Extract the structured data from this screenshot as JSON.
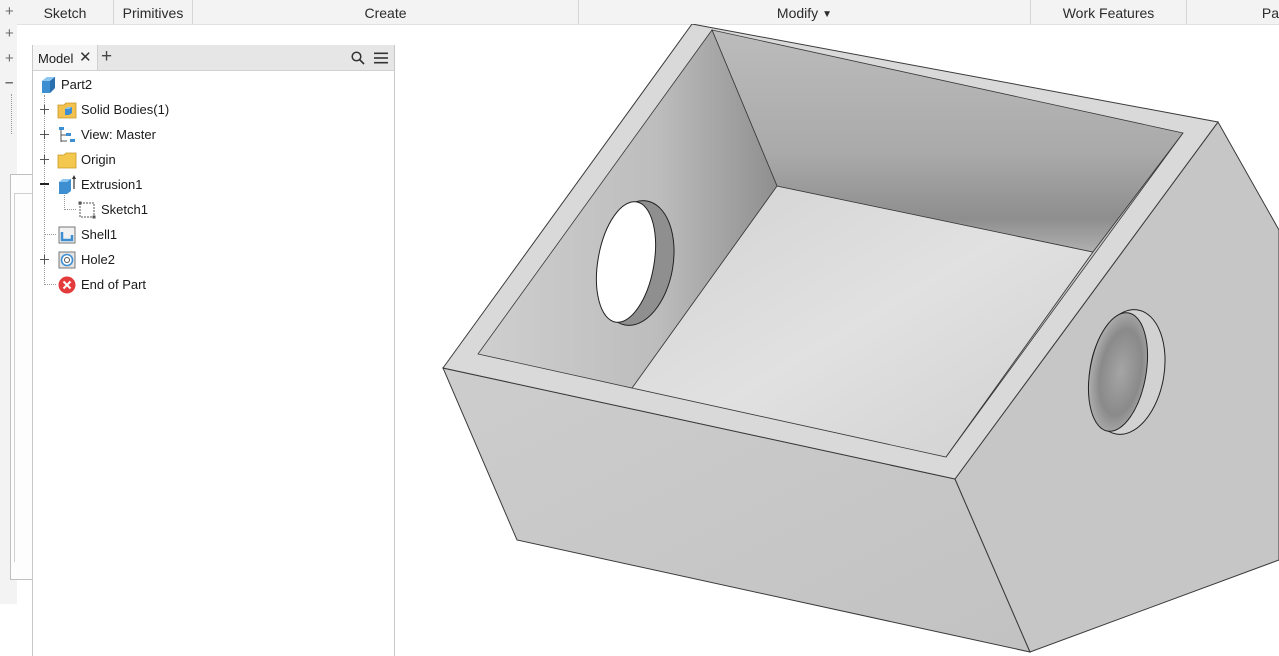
{
  "ribbon": {
    "tabs": [
      {
        "label": "Sketch"
      },
      {
        "label": "Primitives"
      },
      {
        "label": "Create"
      },
      {
        "label": "Modify"
      },
      {
        "label": "Work Features"
      },
      {
        "label": "Pa"
      }
    ]
  },
  "browser": {
    "tab_label": "Model",
    "tree": [
      {
        "label": "Part2",
        "icon": "part-icon"
      },
      {
        "label": "Solid Bodies(1)",
        "icon": "solid-bodies-folder-icon",
        "toggle": "plus"
      },
      {
        "label": "View: Master",
        "icon": "view-rep-icon",
        "toggle": "plus"
      },
      {
        "label": "Origin",
        "icon": "folder-icon",
        "toggle": "plus"
      },
      {
        "label": "Extrusion1",
        "icon": "extrusion-icon",
        "toggle": "minus"
      },
      {
        "label": "Sketch1",
        "icon": "sketch-icon"
      },
      {
        "label": "Shell1",
        "icon": "shell-icon"
      },
      {
        "label": "Hole2",
        "icon": "hole-icon",
        "toggle": "plus"
      },
      {
        "label": "End of Part",
        "icon": "end-of-part-icon"
      }
    ]
  },
  "colors": {
    "ribbon_bg": "#f3f3f3",
    "browser_header": "#e6e6e6",
    "model_face": "#d4d4d4",
    "error_red": "#e33b3b",
    "folder_yellow": "#f4c84f",
    "part_blue": "#4aa3df"
  }
}
